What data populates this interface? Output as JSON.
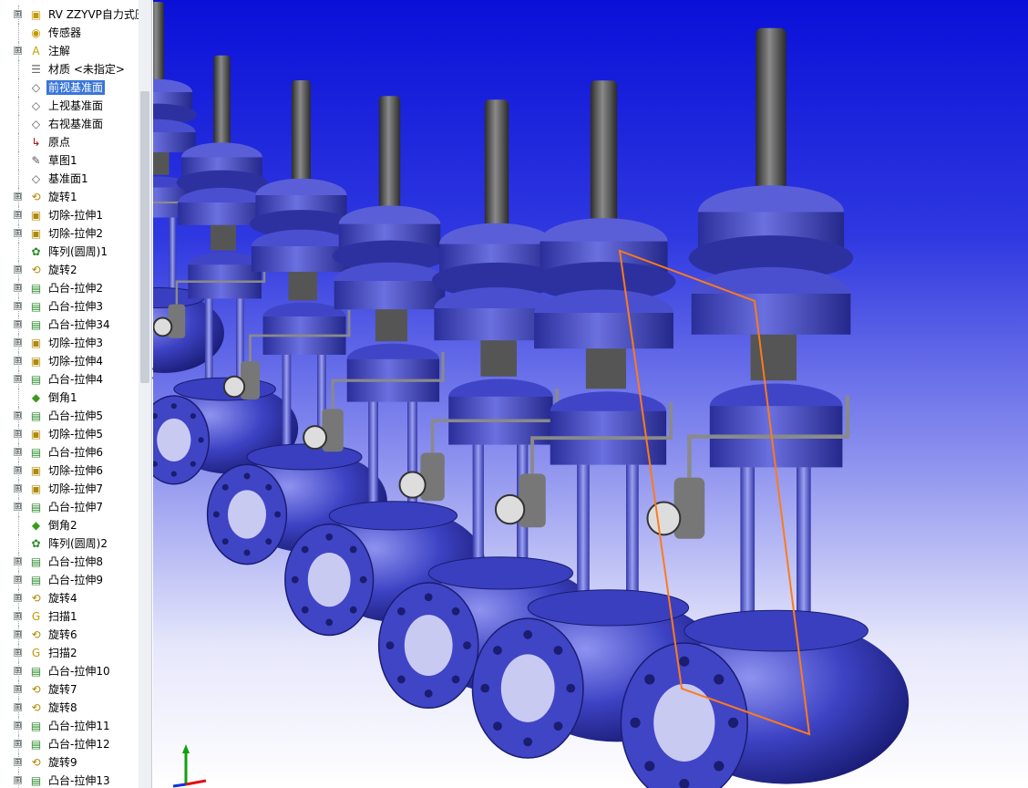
{
  "tree": {
    "items": [
      {
        "label": "RV ZZYVP自力式压",
        "icon": "part-icon",
        "expander": "⊞"
      },
      {
        "label": "传感器",
        "icon": "sensor-icon",
        "expander": ""
      },
      {
        "label": "注解",
        "icon": "annotation-icon",
        "expander": "⊞"
      },
      {
        "label": "材质 <未指定>",
        "icon": "material-icon",
        "expander": ""
      },
      {
        "label": "前视基准面",
        "icon": "plane-icon",
        "expander": "",
        "selected": true
      },
      {
        "label": "上视基准面",
        "icon": "plane-icon",
        "expander": ""
      },
      {
        "label": "右视基准面",
        "icon": "plane-icon",
        "expander": ""
      },
      {
        "label": "原点",
        "icon": "origin-icon",
        "expander": ""
      },
      {
        "label": "草图1",
        "icon": "sketch-icon",
        "expander": ""
      },
      {
        "label": "基准面1",
        "icon": "plane-icon",
        "expander": ""
      },
      {
        "label": "旋转1",
        "icon": "revolve-icon",
        "expander": "⊞"
      },
      {
        "label": "切除-拉伸1",
        "icon": "cut-extrude-icon",
        "expander": "⊞"
      },
      {
        "label": "切除-拉伸2",
        "icon": "cut-extrude-icon",
        "expander": "⊞"
      },
      {
        "label": "阵列(圆周)1",
        "icon": "circular-pattern-icon",
        "expander": ""
      },
      {
        "label": "旋转2",
        "icon": "revolve-icon",
        "expander": "⊞"
      },
      {
        "label": "凸台-拉伸2",
        "icon": "boss-extrude-icon",
        "expander": "⊞"
      },
      {
        "label": "凸台-拉伸3",
        "icon": "boss-extrude-icon",
        "expander": "⊞"
      },
      {
        "label": "凸台-拉伸34",
        "icon": "boss-extrude-icon",
        "expander": "⊞"
      },
      {
        "label": "切除-拉伸3",
        "icon": "cut-extrude-icon",
        "expander": "⊞"
      },
      {
        "label": "切除-拉伸4",
        "icon": "cut-extrude-icon",
        "expander": "⊞"
      },
      {
        "label": "凸台-拉伸4",
        "icon": "boss-extrude-icon",
        "expander": "⊞"
      },
      {
        "label": "倒角1",
        "icon": "chamfer-icon",
        "expander": ""
      },
      {
        "label": "凸台-拉伸5",
        "icon": "boss-extrude-icon",
        "expander": "⊞"
      },
      {
        "label": "切除-拉伸5",
        "icon": "cut-extrude-icon",
        "expander": "⊞"
      },
      {
        "label": "凸台-拉伸6",
        "icon": "boss-extrude-icon",
        "expander": "⊞"
      },
      {
        "label": "切除-拉伸6",
        "icon": "cut-extrude-icon",
        "expander": "⊞"
      },
      {
        "label": "切除-拉伸7",
        "icon": "cut-extrude-icon",
        "expander": "⊞"
      },
      {
        "label": "凸台-拉伸7",
        "icon": "boss-extrude-icon",
        "expander": "⊞"
      },
      {
        "label": "倒角2",
        "icon": "chamfer-icon",
        "expander": ""
      },
      {
        "label": "阵列(圆周)2",
        "icon": "circular-pattern-icon",
        "expander": ""
      },
      {
        "label": "凸台-拉伸8",
        "icon": "boss-extrude-icon",
        "expander": "⊞"
      },
      {
        "label": "凸台-拉伸9",
        "icon": "boss-extrude-icon",
        "expander": "⊞"
      },
      {
        "label": "旋转4",
        "icon": "revolve-icon",
        "expander": "⊞"
      },
      {
        "label": "扫描1",
        "icon": "sweep-icon",
        "expander": "⊞"
      },
      {
        "label": "旋转6",
        "icon": "revolve-icon",
        "expander": "⊞"
      },
      {
        "label": "扫描2",
        "icon": "sweep-icon",
        "expander": "⊞"
      },
      {
        "label": "凸台-拉伸10",
        "icon": "boss-extrude-icon",
        "expander": "⊞"
      },
      {
        "label": "旋转7",
        "icon": "revolve-icon",
        "expander": "⊞"
      },
      {
        "label": "旋转8",
        "icon": "revolve-icon",
        "expander": "⊞"
      },
      {
        "label": "凸台-拉伸11",
        "icon": "boss-extrude-icon",
        "expander": "⊞"
      },
      {
        "label": "凸台-拉伸12",
        "icon": "boss-extrude-icon",
        "expander": "⊞"
      },
      {
        "label": "旋转9",
        "icon": "revolve-icon",
        "expander": "⊞"
      },
      {
        "label": "凸台-拉伸13",
        "icon": "boss-extrude-icon",
        "expander": "⊞"
      }
    ]
  },
  "viewport": {
    "triad_axes": [
      "x-axis",
      "y-axis",
      "z-axis"
    ],
    "colors": {
      "valve_body": "#3b3fbf",
      "valve_highlight": "#7d82ea",
      "stem": "#4a4a4a",
      "selection_plane": "#ff7a1a",
      "triad_x": "#e01010",
      "triad_y": "#10a010",
      "triad_z": "#1030e0"
    }
  }
}
